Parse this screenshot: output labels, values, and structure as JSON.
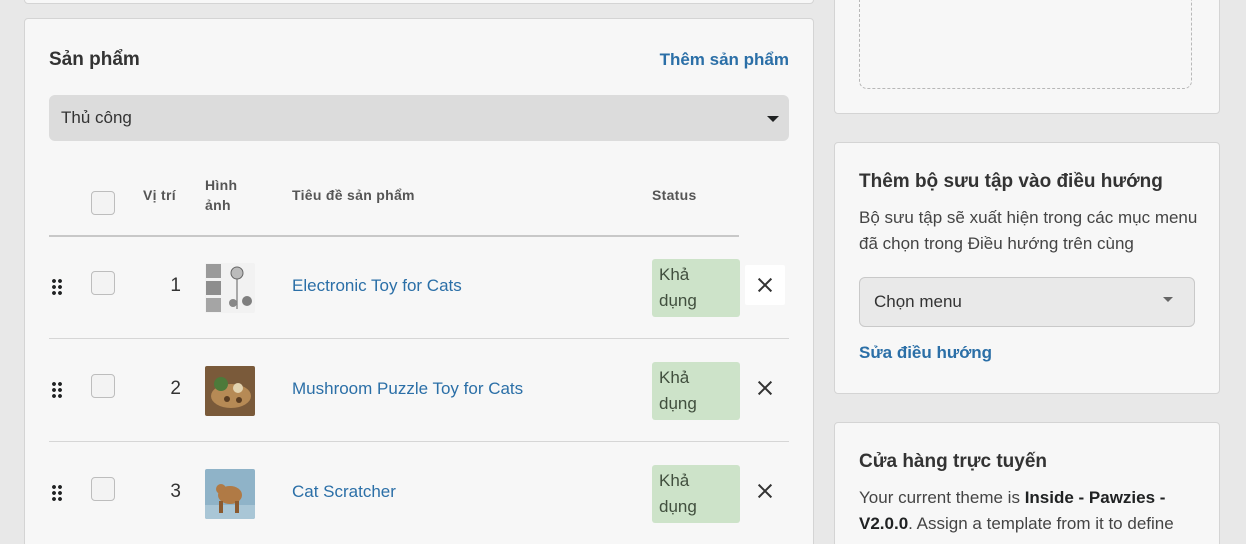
{
  "products_card": {
    "title": "Sản phẩm",
    "add_link": "Thêm sản phẩm",
    "sort_value": "Thủ công",
    "headers": {
      "position": "Vị trí",
      "image_line1": "Hình",
      "image_line2": "ảnh",
      "title": "Tiêu đề sản phẩm",
      "status": "Status"
    },
    "rows": [
      {
        "position": "1",
        "title": "Electronic Toy for Cats",
        "status_line1": "Khả",
        "status_line2": "dụng"
      },
      {
        "position": "2",
        "title": "Mushroom Puzzle Toy for Cats",
        "status_line1": "Khả",
        "status_line2": "dụng"
      },
      {
        "position": "3",
        "title": "Cat Scratcher",
        "status_line1": "Khả",
        "status_line2": "dụng"
      }
    ]
  },
  "nav_card": {
    "title": "Thêm bộ sưu tập vào điều hướng",
    "description": "Bộ sưu tập sẽ xuất hiện trong các mục menu đã chọn trong Điều hướng trên cùng",
    "menu_select": "Chọn menu",
    "edit_link": "Sửa điều hướng"
  },
  "online_card": {
    "title": "Cửa hàng trực tuyến",
    "desc_prefix": "Your current theme is ",
    "theme_name": "Inside - Pawzies - V2.0.0",
    "desc_suffix": ". Assign a template from it to define"
  },
  "icons": {
    "drag": "drag-handle-icon",
    "remove": "close-icon",
    "caret": "caret-down-icon"
  },
  "colors": {
    "link": "#2b6fa7",
    "badge_bg": "#cde3c9",
    "page_bg": "#e8e8e8"
  }
}
